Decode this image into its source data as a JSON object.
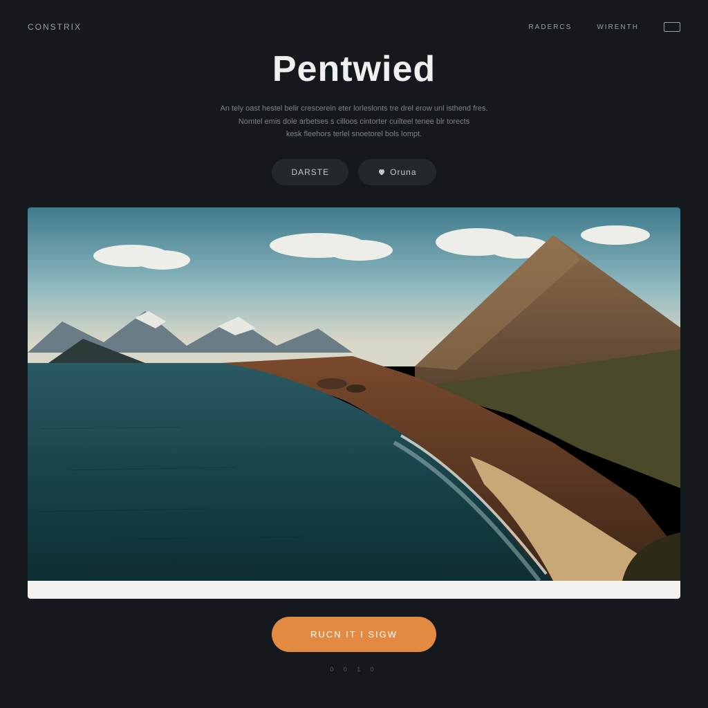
{
  "nav": {
    "brand": "CONSTRIX",
    "links": [
      "RADERCS",
      "WIRENTH"
    ]
  },
  "hero": {
    "title": "Pentwied",
    "subtitle_l1": "An tely oast hestel belir crescerein eter lorleslonts tre drel erow unl isthend fres.",
    "subtitle_l2": "Nomtel emis dole arbetses s cilloos cintorter cuilteel tenee blr torects",
    "subtitle_l3": "kesk fleehors terlel snoetorel bols lompt."
  },
  "buttons": {
    "primary": "DARSTE",
    "secondary": "Oruna"
  },
  "image_caption": "",
  "cta": "RUCN IT I SIGW",
  "pagination": "0  0  1  0"
}
